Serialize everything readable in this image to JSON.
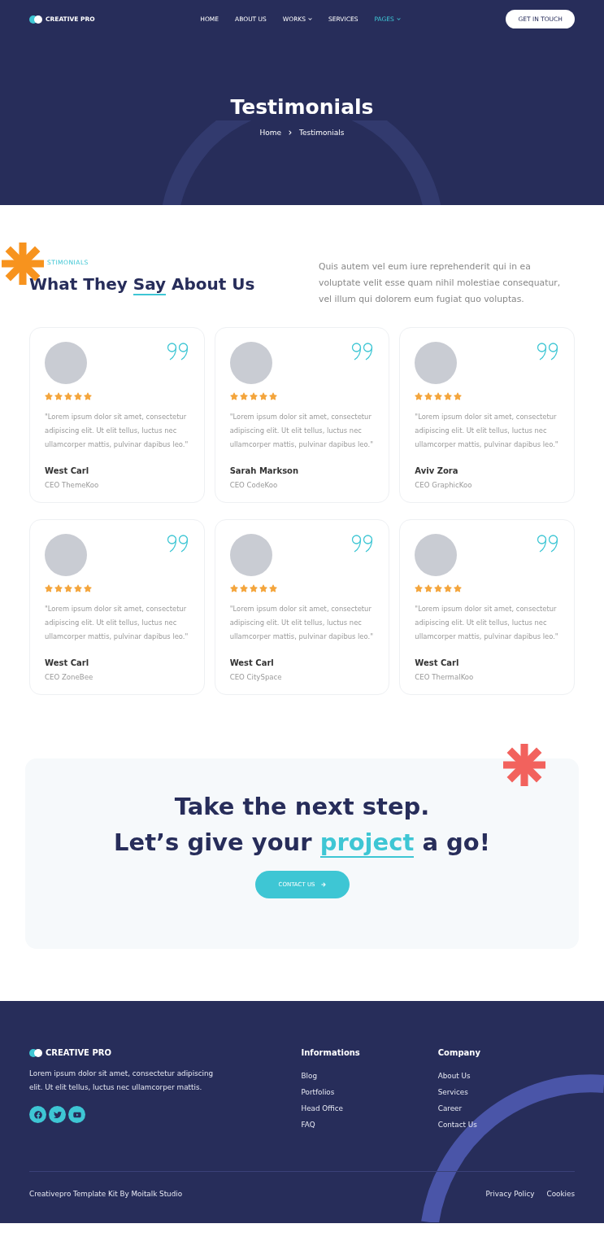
{
  "header": {
    "logo": "CREATIVE PRO",
    "nav": [
      {
        "label": "HOME",
        "selected": false,
        "dropdown": false
      },
      {
        "label": "ABOUT US",
        "selected": false,
        "dropdown": false
      },
      {
        "label": "WORKS",
        "selected": false,
        "dropdown": true
      },
      {
        "label": "SERVICES",
        "selected": false,
        "dropdown": false
      },
      {
        "label": "PAGES",
        "selected": true,
        "dropdown": true
      }
    ],
    "cta": "GET IN TOUCH"
  },
  "hero": {
    "title": "Testimonials",
    "breadcrumb": [
      "Home",
      "Testimonials"
    ]
  },
  "intro": {
    "eyebrow": "STIMONIALS",
    "heading_before": "What They ",
    "heading_highlight": "Say",
    "heading_after": " About Us",
    "text": "Quis autem vel eum iure reprehenderit qui in ea voluptate velit esse quam nihil molestiae consequatur, vel illum qui dolorem eum fugiat quo voluptas."
  },
  "testimonials": [
    {
      "stars": 5,
      "quote": "\"Lorem ipsum dolor sit amet, consectetur adipiscing elit. Ut elit tellus, luctus nec ullamcorper mattis, pulvinar dapibus leo.\"",
      "name": "West Carl",
      "role": "CEO ThemeKoo"
    },
    {
      "stars": 5,
      "quote": "\"Lorem ipsum dolor sit amet, consectetur adipiscing elit. Ut elit tellus, luctus nec ullamcorper mattis, pulvinar dapibus leo.\"",
      "name": "Sarah Markson",
      "role": "CEO CodeKoo"
    },
    {
      "stars": 5,
      "quote": "\"Lorem ipsum dolor sit amet, consectetur adipiscing elit. Ut elit tellus, luctus nec ullamcorper mattis, pulvinar dapibus leo.\"",
      "name": "Aviv Zora",
      "role": "CEO GraphicKoo"
    },
    {
      "stars": 5,
      "quote": "\"Lorem ipsum dolor sit amet, consectetur adipiscing elit. Ut elit tellus, luctus nec ullamcorper mattis, pulvinar dapibus leo.\"",
      "name": "West Carl",
      "role": "CEO ZoneBee"
    },
    {
      "stars": 5,
      "quote": "\"Lorem ipsum dolor sit amet, consectetur adipiscing elit. Ut elit tellus, luctus nec ullamcorper mattis, pulvinar dapibus leo.\"",
      "name": "West Carl",
      "role": "CEO CitySpace"
    },
    {
      "stars": 5,
      "quote": "\"Lorem ipsum dolor sit amet, consectetur adipiscing elit. Ut elit tellus, luctus nec ullamcorper mattis, pulvinar dapibus leo.\"",
      "name": "West Carl",
      "role": "CEO ThermalKoo"
    }
  ],
  "cta_section": {
    "line1": "Take the next step.",
    "line2_before": "Let’s give your ",
    "line2_highlight": "project",
    "line2_after": " a go!",
    "button": "CONTACT US"
  },
  "footer": {
    "logo": "CREATIVE PRO",
    "text": "Lorem ipsum dolor sit amet, consectetur adipiscing elit. Ut elit tellus, luctus nec ullamcorper mattis.",
    "social": [
      {
        "kind": "facebook"
      },
      {
        "kind": "twitter"
      },
      {
        "kind": "youtube"
      }
    ],
    "columns": [
      {
        "title": "Informations",
        "links": [
          "Blog",
          "Portfolios",
          "Head Office",
          "FAQ"
        ]
      },
      {
        "title": "Company",
        "links": [
          "About Us",
          "Services",
          "Career",
          "Contact Us"
        ]
      }
    ],
    "copyright": "Creativepro Template Kit By Moitalk Studio",
    "legal": [
      "Privacy Policy",
      "Cookies"
    ]
  }
}
